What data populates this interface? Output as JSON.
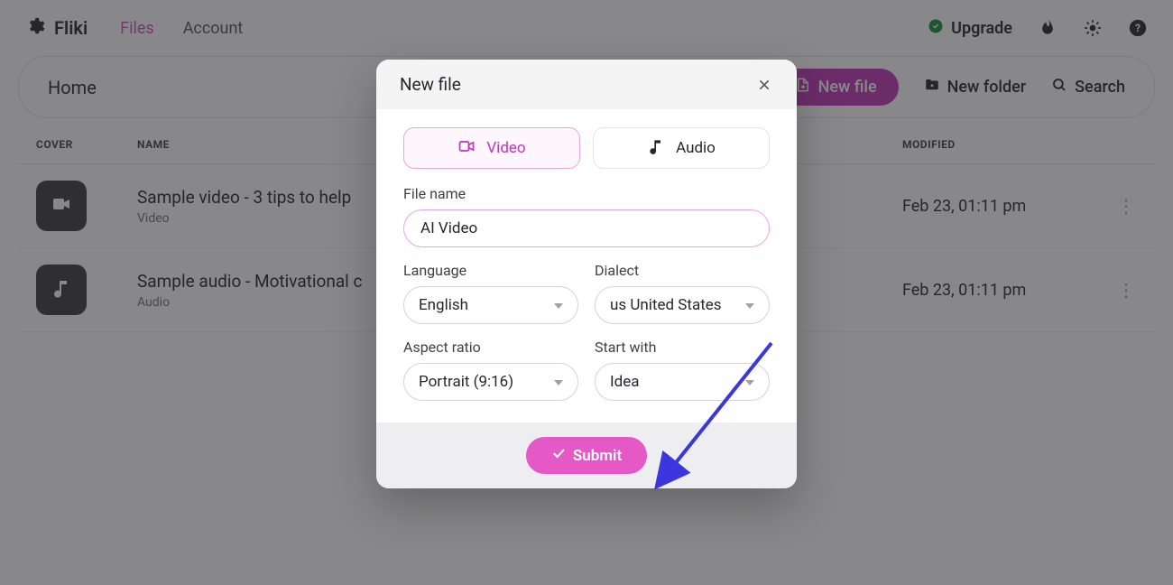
{
  "brand": {
    "name": "Fliki"
  },
  "nav": {
    "files": "Files",
    "account": "Account",
    "upgrade": "Upgrade"
  },
  "toolbar": {
    "breadcrumb": "Home",
    "new_file": "New file",
    "new_folder": "New folder",
    "search": "Search"
  },
  "table": {
    "headers": {
      "cover": "COVER",
      "name": "NAME",
      "modified": "MODIFIED"
    },
    "rows": [
      {
        "title": "Sample video - 3 tips to help ",
        "subtitle": "Video",
        "modified": "Feb 23, 01:11 pm",
        "kind": "video"
      },
      {
        "title": "Sample audio - Motivational c",
        "subtitle": "Audio",
        "modified": "Feb 23, 01:11 pm",
        "kind": "audio"
      }
    ]
  },
  "modal": {
    "title": "New file",
    "tabs": {
      "video": "Video",
      "audio": "Audio"
    },
    "labels": {
      "file_name": "File name",
      "language": "Language",
      "dialect": "Dialect",
      "aspect_ratio": "Aspect ratio",
      "start_with": "Start with"
    },
    "values": {
      "file_name": "AI Video",
      "language": "English",
      "dialect": "us United States",
      "aspect_ratio": "Portrait (9:16)",
      "start_with": "Idea"
    },
    "submit": "Submit"
  },
  "colors": {
    "accent": "#c234b8",
    "accent_hover": "#e559c6",
    "upgrade_badge": "#1a8f3c"
  }
}
